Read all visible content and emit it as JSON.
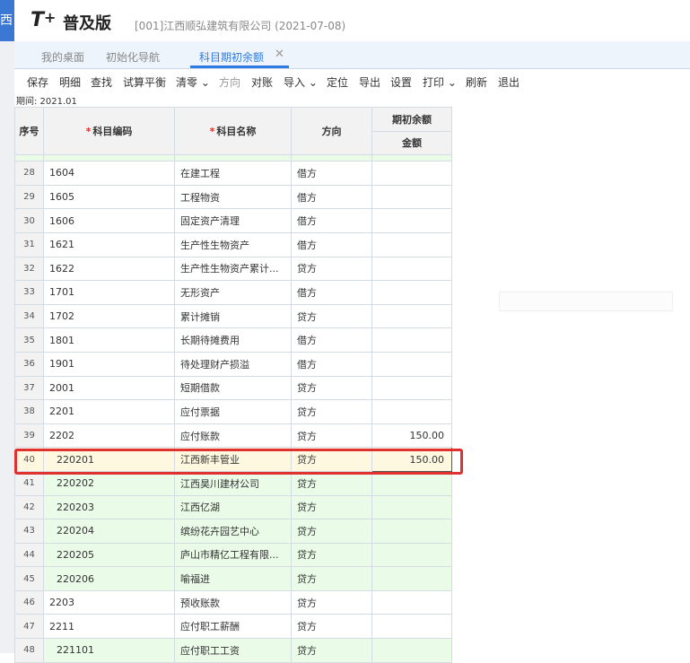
{
  "app": {
    "logo_mark": "T",
    "logo_plus": "+",
    "edition": "普及版",
    "company": "[001]江西顺弘建筑有限公司   (2021-07-08)"
  },
  "tabs": [
    {
      "label": "我的桌面"
    },
    {
      "label": "初始化导航"
    },
    {
      "label": "科目期初余额",
      "active": true
    }
  ],
  "toolbar": [
    {
      "label": "保存"
    },
    {
      "label": "明细"
    },
    {
      "label": "查找"
    },
    {
      "label": "试算平衡"
    },
    {
      "label": "清零 ⌄"
    },
    {
      "label": "方向",
      "disabled": true
    },
    {
      "label": "对账"
    },
    {
      "label": "导入 ⌄"
    },
    {
      "label": "定位"
    },
    {
      "label": "导出"
    },
    {
      "label": "设置"
    },
    {
      "label": "打印 ⌄"
    },
    {
      "label": "刷新"
    },
    {
      "label": "退出"
    }
  ],
  "period": "期间: 2021.01",
  "table": {
    "headers": {
      "index": "序号",
      "code": "科目编码",
      "name": "科目名称",
      "direction": "方向",
      "opening_balance": "期初余额",
      "amount": "金额"
    },
    "rows": [
      {
        "n": "28",
        "code": "1604",
        "name": "在建工程",
        "dir": "借方",
        "amt": ""
      },
      {
        "n": "29",
        "code": "1605",
        "name": "工程物资",
        "dir": "借方",
        "amt": ""
      },
      {
        "n": "30",
        "code": "1606",
        "name": "固定资产清理",
        "dir": "借方",
        "amt": ""
      },
      {
        "n": "31",
        "code": "1621",
        "name": "生产性生物资产",
        "dir": "借方",
        "amt": ""
      },
      {
        "n": "32",
        "code": "1622",
        "name": "生产性生物资产累计...",
        "dir": "贷方",
        "amt": ""
      },
      {
        "n": "33",
        "code": "1701",
        "name": "无形资产",
        "dir": "借方",
        "amt": ""
      },
      {
        "n": "34",
        "code": "1702",
        "name": "累计摊销",
        "dir": "贷方",
        "amt": ""
      },
      {
        "n": "35",
        "code": "1801",
        "name": "长期待摊费用",
        "dir": "借方",
        "amt": ""
      },
      {
        "n": "36",
        "code": "1901",
        "name": "待处理财产损溢",
        "dir": "借方",
        "amt": ""
      },
      {
        "n": "37",
        "code": "2001",
        "name": "短期借款",
        "dir": "贷方",
        "amt": ""
      },
      {
        "n": "38",
        "code": "2201",
        "name": "应付票据",
        "dir": "贷方",
        "amt": ""
      },
      {
        "n": "39",
        "code": "2202",
        "name": "应付账款",
        "dir": "贷方",
        "amt": "150.00"
      },
      {
        "n": "40",
        "code": "220201",
        "name": "江西新丰管业",
        "dir": "贷方",
        "amt": "150.00"
      },
      {
        "n": "41",
        "code": "220202",
        "name": "江西昊川建材公司",
        "dir": "贷方",
        "amt": ""
      },
      {
        "n": "42",
        "code": "220203",
        "name": "江西亿湖",
        "dir": "贷方",
        "amt": ""
      },
      {
        "n": "43",
        "code": "220204",
        "name": "缤纷花卉园艺中心",
        "dir": "贷方",
        "amt": ""
      },
      {
        "n": "44",
        "code": "220205",
        "name": "庐山市精亿工程有限...",
        "dir": "贷方",
        "amt": ""
      },
      {
        "n": "45",
        "code": "220206",
        "name": "喻福进",
        "dir": "贷方",
        "amt": ""
      },
      {
        "n": "46",
        "code": "2203",
        "name": "预收账款",
        "dir": "贷方",
        "amt": ""
      },
      {
        "n": "47",
        "code": "2211",
        "name": "应付职工薪酬",
        "dir": "贷方",
        "amt": ""
      },
      {
        "n": "48",
        "code": "221101",
        "name": "应付职工工资",
        "dir": "贷方",
        "amt": ""
      }
    ]
  }
}
